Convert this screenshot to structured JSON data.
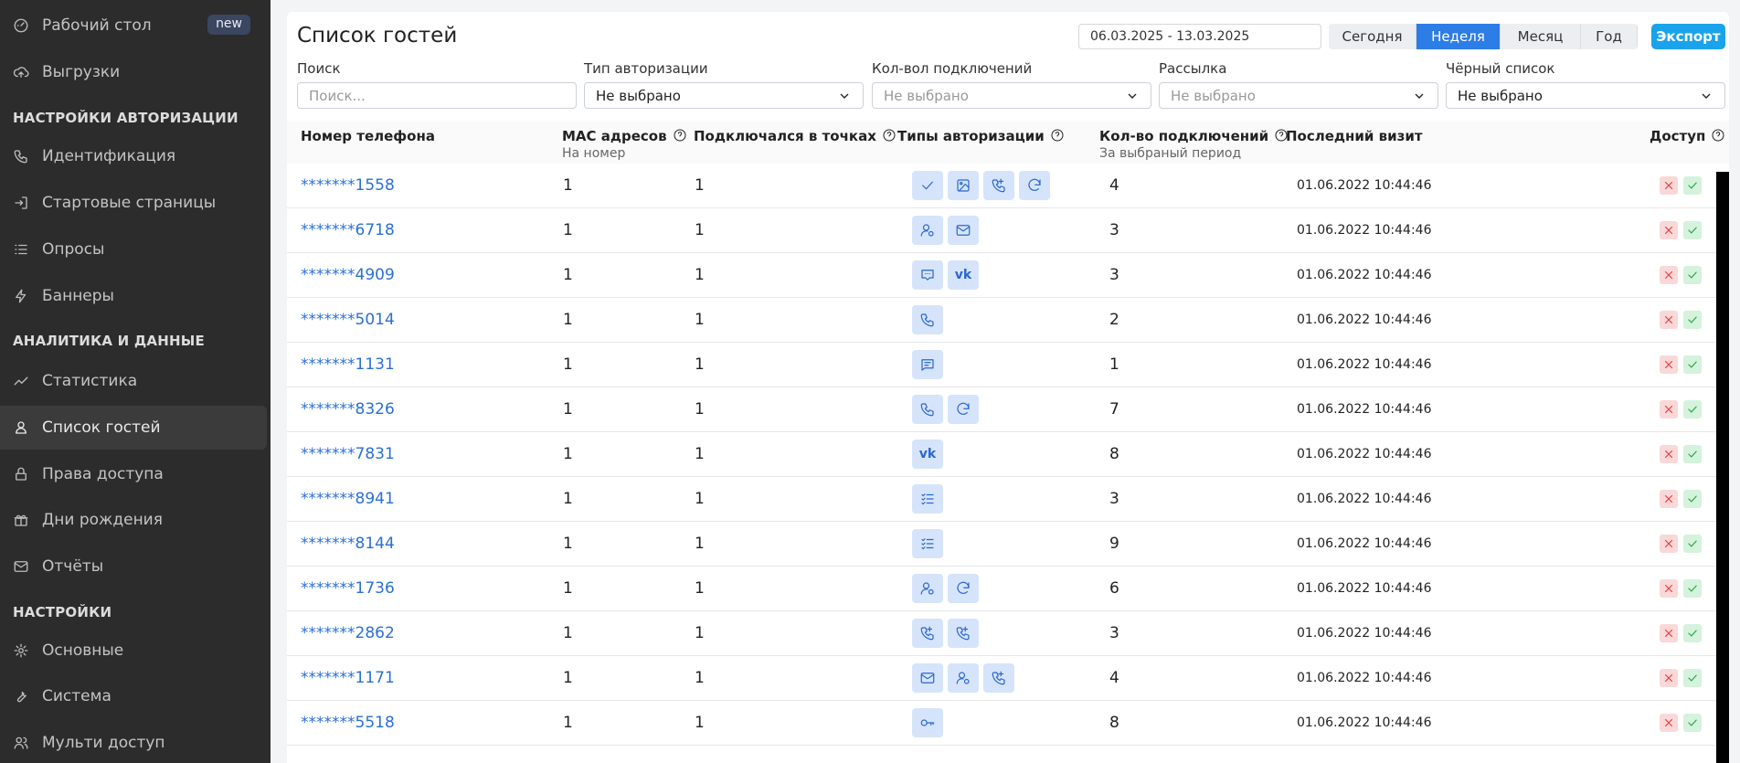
{
  "sidebar": {
    "top_items": [
      {
        "label": "Рабочий стол",
        "icon": "gauge-icon",
        "badge": "new"
      },
      {
        "label": "Выгрузки",
        "icon": "cloud-upload-icon"
      }
    ],
    "sections": [
      {
        "title": "НАСТРОЙКИ АВТОРИЗАЦИИ",
        "items": [
          {
            "label": "Идентификация",
            "icon": "phone-icon"
          },
          {
            "label": "Стартовые страницы",
            "icon": "login-icon"
          },
          {
            "label": "Опросы",
            "icon": "list-icon"
          },
          {
            "label": "Баннеры",
            "icon": "bolt-icon"
          }
        ]
      },
      {
        "title": "АНАЛИТИКА И ДАННЫЕ",
        "items": [
          {
            "label": "Статистика",
            "icon": "trend-icon"
          },
          {
            "label": "Список гостей",
            "icon": "user-icon",
            "active": true
          },
          {
            "label": "Права доступа",
            "icon": "lock-icon"
          },
          {
            "label": "Дни рождения",
            "icon": "gift-icon"
          },
          {
            "label": "Отчёты",
            "icon": "mail-icon"
          }
        ]
      },
      {
        "title": "НАСТРОЙКИ",
        "items": [
          {
            "label": "Основные",
            "icon": "gear-icon"
          },
          {
            "label": "Система",
            "icon": "wrench-icon"
          },
          {
            "label": "Мульти доступ",
            "icon": "users-icon"
          }
        ]
      }
    ]
  },
  "header": {
    "title": "Список гостей",
    "date_range": "06.03.2025 - 13.03.2025",
    "periods": [
      {
        "label": "Сегодня",
        "active": false
      },
      {
        "label": "Неделя",
        "active": true
      },
      {
        "label": "Месяц",
        "active": false
      },
      {
        "label": "Год",
        "active": false
      }
    ],
    "export_label": "Экспорт"
  },
  "filters": [
    {
      "label": "Поиск",
      "value": "",
      "placeholder": "Поиск...",
      "type": "input"
    },
    {
      "label": "Тип авторизации",
      "value": "Не выбрано",
      "type": "select"
    },
    {
      "label": "Кол-вол подключений",
      "value": "Не выбрано",
      "type": "select",
      "muted": true
    },
    {
      "label": "Рассылка",
      "value": "Не выбрано",
      "type": "select",
      "muted": true
    },
    {
      "label": "Чёрный список",
      "value": "Не выбрано",
      "type": "select"
    }
  ],
  "table": {
    "columns": [
      {
        "label": "Номер телефона",
        "sub": "",
        "help": false
      },
      {
        "label": "MAC адресов",
        "sub": "На номер",
        "help": true
      },
      {
        "label": "Подключался в точках",
        "sub": "",
        "help": true
      },
      {
        "label": "Типы авторизации",
        "sub": "",
        "help": true
      },
      {
        "label": "Кол-во подключений",
        "sub": "За выбраный период",
        "help": true
      },
      {
        "label": "Последний визит",
        "sub": "",
        "help": false
      },
      {
        "label": "Доступ",
        "sub": "",
        "help": true
      }
    ],
    "rows": [
      {
        "phone": "*******1558",
        "mac": "1",
        "points": "1",
        "auth": [
          "check-icon",
          "image-icon",
          "phone-call-icon",
          "refresh-icon"
        ],
        "count": "4",
        "last_visit": "01.06.2022 10:44:46"
      },
      {
        "phone": "*******6718",
        "mac": "1",
        "points": "1",
        "auth": [
          "user-settings-icon",
          "mail-icon"
        ],
        "count": "3",
        "last_visit": "01.06.2022 10:44:46"
      },
      {
        "phone": "*******4909",
        "mac": "1",
        "points": "1",
        "auth": [
          "message-icon",
          "vk-icon"
        ],
        "count": "3",
        "last_visit": "01.06.2022 10:44:46"
      },
      {
        "phone": "*******5014",
        "mac": "1",
        "points": "1",
        "auth": [
          "phone-icon"
        ],
        "count": "2",
        "last_visit": "01.06.2022 10:44:46"
      },
      {
        "phone": "*******1131",
        "mac": "1",
        "points": "1",
        "auth": [
          "chat-icon"
        ],
        "count": "1",
        "last_visit": "01.06.2022 10:44:46"
      },
      {
        "phone": "*******8326",
        "mac": "1",
        "points": "1",
        "auth": [
          "phone-icon",
          "refresh-icon"
        ],
        "count": "7",
        "last_visit": "01.06.2022 10:44:46"
      },
      {
        "phone": "*******7831",
        "mac": "1",
        "points": "1",
        "auth": [
          "vk-icon"
        ],
        "count": "8",
        "last_visit": "01.06.2022 10:44:46"
      },
      {
        "phone": "*******8941",
        "mac": "1",
        "points": "1",
        "auth": [
          "checklist-icon"
        ],
        "count": "3",
        "last_visit": "01.06.2022 10:44:46"
      },
      {
        "phone": "*******8144",
        "mac": "1",
        "points": "1",
        "auth": [
          "checklist-icon"
        ],
        "count": "9",
        "last_visit": "01.06.2022 10:44:46"
      },
      {
        "phone": "*******1736",
        "mac": "1",
        "points": "1",
        "auth": [
          "user-settings-icon",
          "refresh-icon"
        ],
        "count": "6",
        "last_visit": "01.06.2022 10:44:46"
      },
      {
        "phone": "*******2862",
        "mac": "1",
        "points": "1",
        "auth": [
          "phone-call-icon",
          "phone-call-icon"
        ],
        "count": "3",
        "last_visit": "01.06.2022 10:44:46"
      },
      {
        "phone": "*******1171",
        "mac": "1",
        "points": "1",
        "auth": [
          "mail-icon",
          "user-settings-icon",
          "phone-call-icon"
        ],
        "count": "4",
        "last_visit": "01.06.2022 10:44:46"
      },
      {
        "phone": "*******5518",
        "mac": "1",
        "points": "1",
        "auth": [
          "key-icon"
        ],
        "count": "8",
        "last_visit": "01.06.2022 10:44:46"
      }
    ]
  },
  "colors": {
    "accent": "#2d7de6",
    "export": "#1aa3ea",
    "sidebar_bg": "#2c2c2c",
    "link": "#2a6fd6"
  }
}
